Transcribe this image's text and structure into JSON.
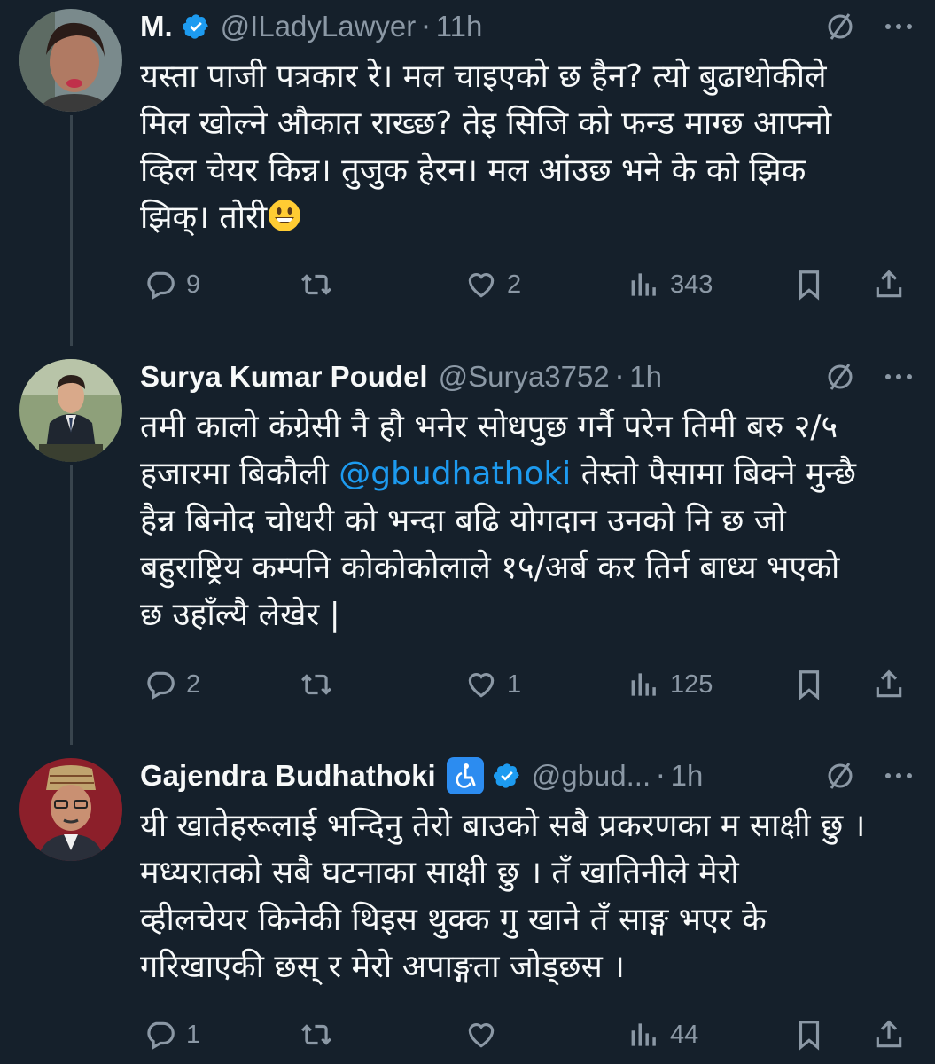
{
  "colors": {
    "background": "#15202b",
    "text": "#f7f9f9",
    "muted": "#8b98a5",
    "link": "#1d9bf0",
    "verified": "#1d9bf0",
    "thread_line": "#38444d"
  },
  "tweets": [
    {
      "name": "M.",
      "handle": "@ILadyLawyer",
      "separator": "·",
      "time": "11h",
      "verified": true,
      "lines": [
        "यस्ता पाजी पत्रकार रे। मल चाइएको छ हैन?  त्यो बुढाथोकीले",
        "मिल खोल्ने औकात राख्छ?  तेइ सिजि को फन्ड माग्छ आफ्नो",
        "व्हिल चेयर किन्न। तुजुक हेरन। मल आंउछ भने के को झिक",
        "झिक्। तोरी"
      ],
      "emoji": "grinning-face-emoji",
      "replies": "9",
      "retweets": "",
      "likes": "2",
      "views": "343"
    },
    {
      "name": "Surya Kumar Poudel",
      "handle": "@Surya3752",
      "separator": "·",
      "time": "1h",
      "verified": false,
      "lines_pre_mention": [
        "तमी कालो कंग्रेसी नै हौ भनेर सोधपुछ गर्नै परेन तिमी बरु २/५"
      ],
      "mention_line_prefix": "हजारमा बिकौली ",
      "mention": "@gbudhathoki",
      "mention_line_suffix": " तेस्तो पैसामा बिक्ने मुन्छै",
      "lines_post_mention": [
        "हैन्न बिनोद चोधरी को भन्दा बढि योगदान उनको नि छ जो",
        "बहुराष्ट्रिय कम्पनि कोकोकोलाले १५/अर्ब कर तिर्न बाध्य भएको",
        "छ उहाँल्यै लेखेर |"
      ],
      "replies": "2",
      "retweets": "",
      "likes": "1",
      "views": "125"
    },
    {
      "name": "Gajendra Budhathoki",
      "handle": "@gbud...",
      "separator": "·",
      "time": "1h",
      "verified": true,
      "name_emoji": "wheelchair-symbol-emoji",
      "lines": [
        "यी खातेहरूलाई भन्दिनु तेरो बाउको सबै प्रकरणका म साक्षी छु ।",
        "मध्यरातको सबै घटनाका साक्षी छु । तँ खातिनीले मेरो",
        "व्हीलचेयर किनेकी थिइस थुक्क गु खाने तँ साङ्ग भएर के",
        "गरिखाएकी छस् र मेरो अपाङ्गता जोड्छस ।"
      ],
      "replies": "1",
      "retweets": "",
      "likes": "",
      "views": "44"
    }
  ]
}
